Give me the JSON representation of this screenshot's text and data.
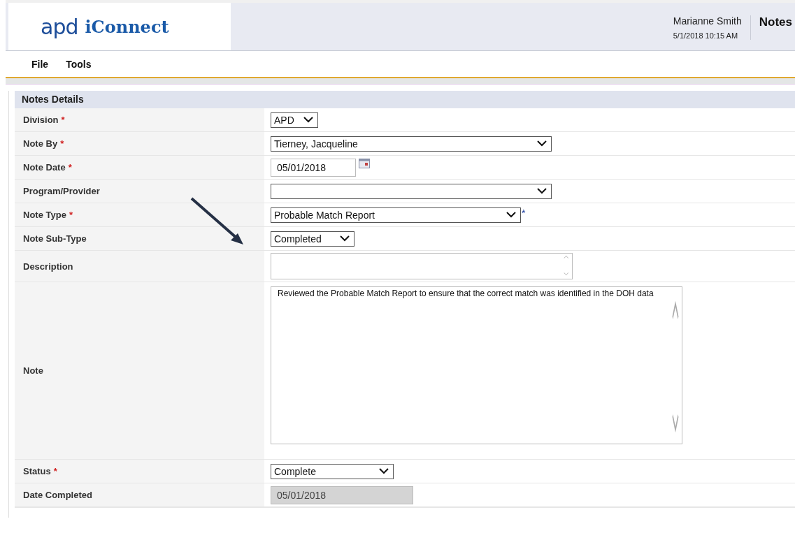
{
  "header": {
    "logo_mark": "apd",
    "logo_text": "iConnect",
    "user": "Marianne Smith",
    "datetime": "5/1/2018 10:15 AM",
    "page_title": "Notes"
  },
  "menu": [
    "File",
    "Tools"
  ],
  "panel": {
    "title": "Notes Details",
    "rows": [
      {
        "label": "Division",
        "required": true,
        "kind": "select",
        "value": "APD"
      },
      {
        "label": "Note By",
        "required": true,
        "kind": "select",
        "value": "Tierney, Jacqueline"
      },
      {
        "label": "Note Date",
        "required": true,
        "kind": "date",
        "value": "05/01/2018"
      },
      {
        "label": "Program/Provider",
        "required": false,
        "kind": "select",
        "value": ""
      },
      {
        "label": "Note Type",
        "required": true,
        "kind": "select",
        "value": "Probable Match Report",
        "after_mark": "*"
      },
      {
        "label": "Note Sub-Type",
        "required": false,
        "kind": "select",
        "value": "Completed"
      },
      {
        "label": "Description",
        "required": false,
        "kind": "textarea",
        "value": ""
      },
      {
        "label": "Note",
        "required": false,
        "kind": "note",
        "value": "Reviewed the Probable Match Report to ensure that the correct match was identified in the DOH data"
      },
      {
        "label": "Status",
        "required": true,
        "kind": "select",
        "value": "Complete"
      },
      {
        "label": "Date Completed",
        "required": false,
        "kind": "readonly",
        "value": "05/01/2018"
      }
    ]
  }
}
